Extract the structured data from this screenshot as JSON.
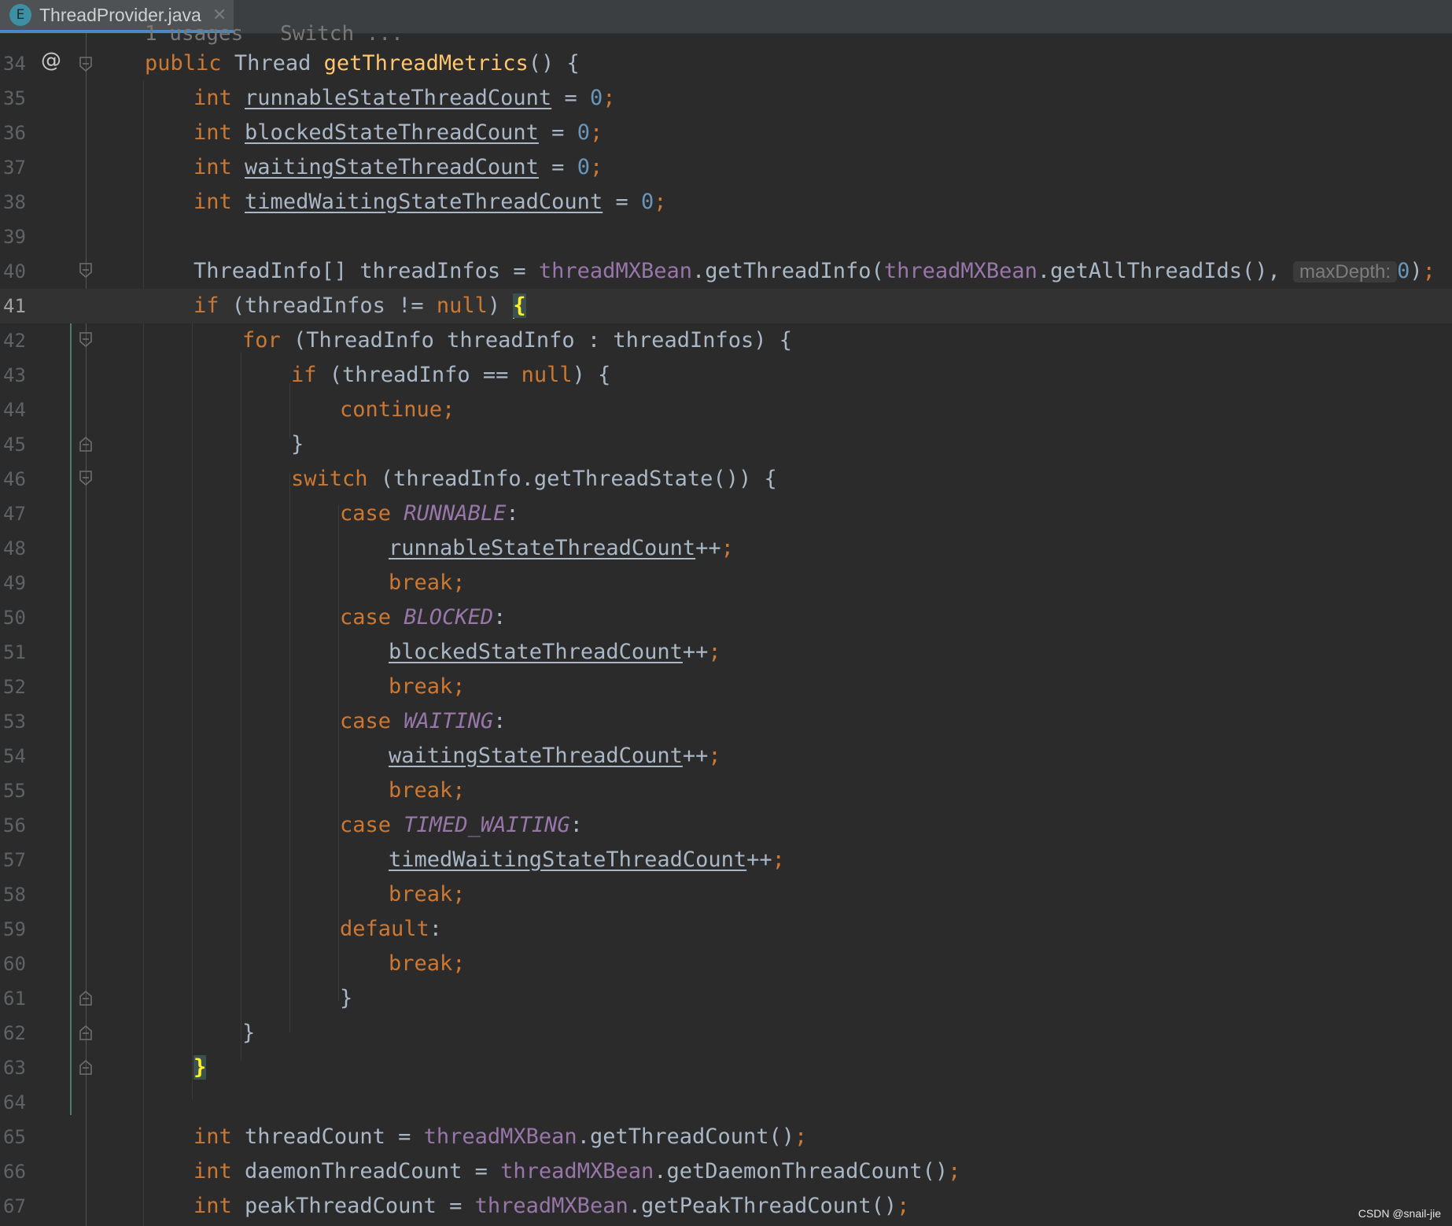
{
  "tab": {
    "icon_letter": "E",
    "filename": "ThreadProvider.java",
    "close_glyph": "✕"
  },
  "editor": {
    "clipped_header": "1 usages   Switch ...",
    "gutter_marker": "@",
    "param_hint": "maxDepth:"
  },
  "lines": {
    "l34": "34",
    "l35": "35",
    "l36": "36",
    "l37": "37",
    "l38": "38",
    "l39": "39",
    "l40": "40",
    "l41": "41",
    "l42": "42",
    "l43": "43",
    "l44": "44",
    "l45": "45",
    "l46": "46",
    "l47": "47",
    "l48": "48",
    "l49": "49",
    "l50": "50",
    "l51": "51",
    "l52": "52",
    "l53": "53",
    "l54": "54",
    "l55": "55",
    "l56": "56",
    "l57": "57",
    "l58": "58",
    "l59": "59",
    "l60": "60",
    "l61": "61",
    "l62": "62",
    "l63": "63",
    "l64": "64",
    "l65": "65",
    "l66": "66",
    "l67": "67"
  },
  "tokens": {
    "public": "public",
    "Thread": "Thread",
    "getThreadMetrics": "getThreadMetrics",
    "int": "int",
    "runnable": "runnableStateThreadCount",
    "blocked": "blockedStateThreadCount",
    "waiting": "waitingStateThreadCount",
    "timed": "timedWaitingStateThreadCount",
    "zero": "0",
    "ThreadInfoArr": "ThreadInfo[] threadInfos = ",
    "threadMXBean": "threadMXBean",
    "getThreadInfo": ".getThreadInfo(",
    "getAllThreadIds": ".getAllThreadIds(), ",
    "if": "if",
    "threadInfosNotNull": " (threadInfos != ",
    "null": "null",
    "for": "for",
    "forHeader": " (ThreadInfo threadInfo : threadInfos) {",
    "threadInfoEq": " (threadInfo == ",
    "continue": "continue;",
    "switch": "switch",
    "switchHeader": " (threadInfo.getThreadState()) {",
    "case": "case",
    "RUNNABLE": "RUNNABLE",
    "BLOCKED": "BLOCKED",
    "WAITING": "WAITING",
    "TIMED_WAITING": "TIMED_WAITING",
    "break": "break;",
    "default": "default",
    "threadCount": " threadCount = ",
    "getThreadCount": ".getThreadCount()",
    "daemonThreadCount": " daemonThreadCount = ",
    "getDaemonThreadCount": ".getDaemonThreadCount()",
    "peakThreadCount": " peakThreadCount = ",
    "getPeakThreadCount": ".getPeakThreadCount()"
  },
  "colors": {
    "background": "#2b2b2b",
    "keyword": "#cc7832",
    "method": "#ffc66d",
    "number": "#6897bb",
    "field": "#9876aa",
    "text": "#a9b7c6",
    "tab_accent": "#4a88c7"
  },
  "watermark": "CSDN @snail-jie"
}
